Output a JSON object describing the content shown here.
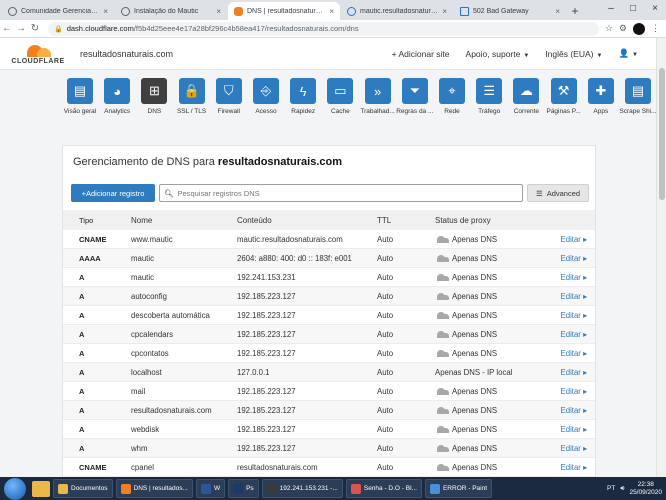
{
  "browser": {
    "tabs": [
      {
        "label": "Comunidade Gerenciando W",
        "icon": "cloud",
        "active": false
      },
      {
        "label": "Instalação do Mautic",
        "icon": "globe",
        "active": false
      },
      {
        "label": "DNS | resultadosnaturais.co",
        "icon": "cloudflare",
        "active": true
      },
      {
        "label": "mautic.resultadosnaturais.co",
        "icon": "loading",
        "active": false
      },
      {
        "label": "502 Bad Gateway",
        "icon": "document",
        "active": false
      }
    ],
    "new_tab": "+",
    "url_host": "dash.cloudflare.com",
    "url_path": "/f5b4d25eee4e17a28bf296c4b58ea417/resultadosnaturais.com/dns"
  },
  "header": {
    "logo_text": "CLOUDFLARE",
    "domain": "resultadosnaturais.com",
    "add_site": "+ Adicionar site",
    "support": "Apoio, suporte",
    "language": "Inglês (EUA)"
  },
  "toolbar": [
    {
      "label": "Visão geral",
      "icon": "clipboard-icon",
      "glyph": "▤"
    },
    {
      "label": "Analytics",
      "icon": "pie-chart-icon",
      "glyph": "◕"
    },
    {
      "label": "DNS",
      "icon": "network-icon",
      "glyph": "⊞",
      "active": true
    },
    {
      "label": "SSL / TLS",
      "icon": "lock-icon",
      "glyph": "🔒"
    },
    {
      "label": "Firewall",
      "icon": "shield-icon",
      "glyph": "⛉"
    },
    {
      "label": "Acesso",
      "icon": "door-icon",
      "glyph": "⎆"
    },
    {
      "label": "Rapidez",
      "icon": "lightning-icon",
      "glyph": "ϟ"
    },
    {
      "label": "Cache",
      "icon": "server-icon",
      "glyph": "▭"
    },
    {
      "label": "Trabalhad...",
      "icon": "workers-icon",
      "glyph": "»"
    },
    {
      "label": "Regras da ...",
      "icon": "filter-icon",
      "glyph": "⏷"
    },
    {
      "label": "Rede",
      "icon": "location-icon",
      "glyph": "⌖"
    },
    {
      "label": "Tráfego",
      "icon": "list-icon",
      "glyph": "☰"
    },
    {
      "label": "Corrente",
      "icon": "cloud-upload-icon",
      "glyph": "☁"
    },
    {
      "label": "Páginas P...",
      "icon": "wrench-icon",
      "glyph": "⚒"
    },
    {
      "label": "Apps",
      "icon": "plus-icon",
      "glyph": "✚"
    },
    {
      "label": "Scrape Shi...",
      "icon": "page-icon",
      "glyph": "▤"
    }
  ],
  "dns": {
    "title_prefix": "Gerenciamento de DNS para",
    "title_domain": "resultadosnaturais.com",
    "add_record": "+Adicionar registro",
    "search_placeholder": "Pesquisar registros DNS",
    "advanced": "Advanced",
    "columns": {
      "type": "Tipo",
      "name": "Nome",
      "content": "Conteúdo",
      "ttl": "TTL",
      "proxy": "Status de proxy"
    },
    "edit_label": "Editar",
    "records": [
      {
        "type": "CNAME",
        "name": "www.mautic",
        "content": "mautic.resultadosnaturais.com",
        "ttl": "Auto",
        "proxy": "Apenas DNS",
        "cloud": true
      },
      {
        "type": "AAAA",
        "name": "mautic",
        "content": "2604: a880: 400: d0 :: 183f: e001",
        "ttl": "Auto",
        "proxy": "Apenas DNS",
        "cloud": true
      },
      {
        "type": "A",
        "name": "mautic",
        "content": "192.241.153.231",
        "ttl": "Auto",
        "proxy": "Apenas DNS",
        "cloud": true
      },
      {
        "type": "A",
        "name": "autoconfig",
        "content": "192.185.223.127",
        "ttl": "Auto",
        "proxy": "Apenas DNS",
        "cloud": true
      },
      {
        "type": "A",
        "name": "descoberta automática",
        "content": "192.185.223.127",
        "ttl": "Auto",
        "proxy": "Apenas DNS",
        "cloud": true
      },
      {
        "type": "A",
        "name": "cpcalendars",
        "content": "192.185.223.127",
        "ttl": "Auto",
        "proxy": "Apenas DNS",
        "cloud": true
      },
      {
        "type": "A",
        "name": "cpcontatos",
        "content": "192.185.223.127",
        "ttl": "Auto",
        "proxy": "Apenas DNS",
        "cloud": true
      },
      {
        "type": "A",
        "name": "localhost",
        "content": "127.0.0.1",
        "ttl": "Auto",
        "proxy": "Apenas DNS - IP local",
        "cloud": false
      },
      {
        "type": "A",
        "name": "mail",
        "content": "192.185.223.127",
        "ttl": "Auto",
        "proxy": "Apenas DNS",
        "cloud": true
      },
      {
        "type": "A",
        "name": "resultadosnaturais.com",
        "content": "192.185.223.127",
        "ttl": "Auto",
        "proxy": "Apenas DNS",
        "cloud": true
      },
      {
        "type": "A",
        "name": "webdisk",
        "content": "192.185.223.127",
        "ttl": "Auto",
        "proxy": "Apenas DNS",
        "cloud": true
      },
      {
        "type": "A",
        "name": "whm",
        "content": "192.185.223.127",
        "ttl": "Auto",
        "proxy": "Apenas DNS",
        "cloud": true
      },
      {
        "type": "CNAME",
        "name": "cpanel",
        "content": "resultadosnaturais.com",
        "ttl": "Auto",
        "proxy": "Apenas DNS",
        "cloud": true
      }
    ]
  },
  "taskbar": {
    "items": [
      {
        "label": "Documentos",
        "color": "#e8b94a"
      },
      {
        "label": "DNS | resultados...",
        "color": "#f38020"
      },
      {
        "label": "W",
        "color": "#2b579a"
      },
      {
        "label": "Ps",
        "color": "#1b3a6b"
      },
      {
        "label": "192.241.153.231 -...",
        "color": "#3a3a3a"
      },
      {
        "label": "Senha - D.O - Bl...",
        "color": "#d9534f"
      },
      {
        "label": "ERROR - Paint",
        "color": "#4a90d9"
      }
    ],
    "lang": "PT",
    "time": "22:38",
    "date": "25/09/2020"
  },
  "colors": {
    "accent": "#2f7bbf",
    "active_tool": "#404041",
    "cloudflare_orange": "#f38020"
  }
}
